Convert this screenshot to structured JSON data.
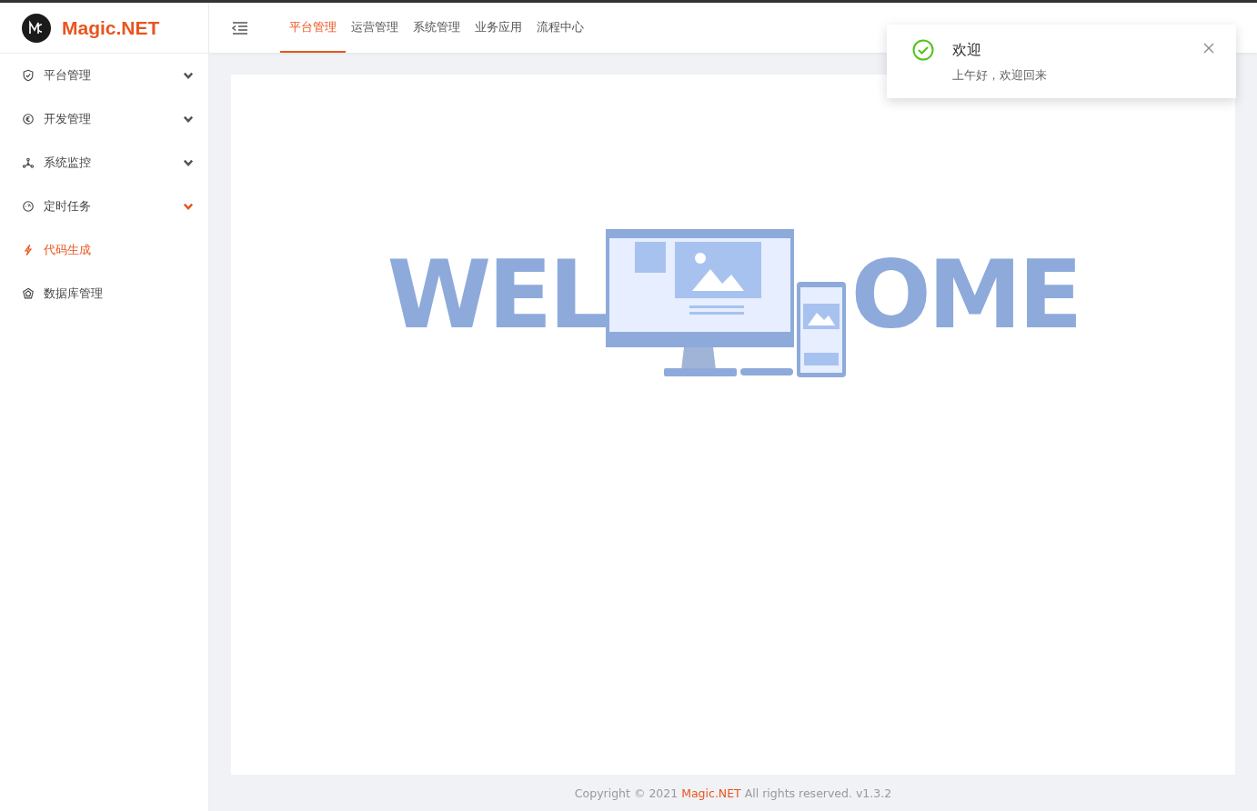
{
  "brand": {
    "name": "Magic.NET"
  },
  "top_tabs": [
    {
      "label": "平台管理",
      "selected": true
    },
    {
      "label": "运营管理",
      "selected": false
    },
    {
      "label": "系统管理",
      "selected": false
    },
    {
      "label": "业务应用",
      "selected": false
    },
    {
      "label": "流程中心",
      "selected": false
    }
  ],
  "sidebar": {
    "items": [
      {
        "label": "平台管理",
        "kind": "submenu",
        "selected": false,
        "active": false
      },
      {
        "label": "开发管理",
        "kind": "submenu",
        "selected": false,
        "active": false
      },
      {
        "label": "系统监控",
        "kind": "submenu",
        "selected": false,
        "active": false
      },
      {
        "label": "定时任务",
        "kind": "submenu",
        "selected": false,
        "active": true
      },
      {
        "label": "代码生成",
        "kind": "link",
        "selected": true
      },
      {
        "label": "数据库管理",
        "kind": "link",
        "selected": false
      }
    ]
  },
  "welcome": {
    "left": "WEL",
    "right": "OME"
  },
  "notification": {
    "title": "欢迎",
    "message": "上午好，欢迎回来"
  },
  "footer": {
    "before": "Copyright © 2021 ",
    "link": "Magic.NET",
    "after": " All rights reserved. v1.3.2"
  }
}
